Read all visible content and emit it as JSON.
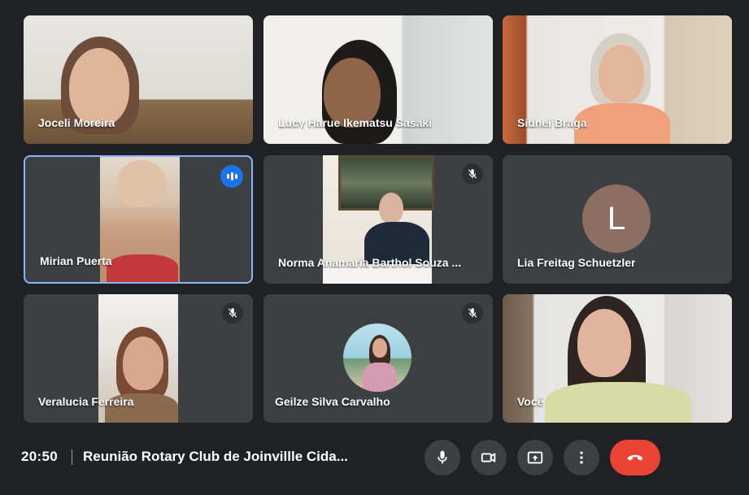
{
  "participants": [
    {
      "name": "Joceli Moreira"
    },
    {
      "name": "Lucy Harue Ikematsu Sasaki"
    },
    {
      "name": "Sidnei Braga"
    },
    {
      "name": "Mirian Puerta"
    },
    {
      "name": "Norma Anamaria Barthol Souza ..."
    },
    {
      "name": "Lia Freitag Schuetzler",
      "initial": "L"
    },
    {
      "name": "Veralucia Ferreira"
    },
    {
      "name": "Geilze Silva Carvalho"
    },
    {
      "name": "Você"
    }
  ],
  "toolbar": {
    "time": "20:50",
    "meeting_title": "Reunião Rotary Club de Joinvillle Cida..."
  },
  "colors": {
    "background": "#202124",
    "tile": "#3c4043",
    "active_border": "#8ab4f8",
    "speaking_indicator": "#1a73e8",
    "end_call": "#ea4335",
    "avatar_L": "#8d6e63"
  },
  "icons": [
    "mic-off-icon",
    "speaking-indicator-icon",
    "mic-icon",
    "camera-icon",
    "present-screen-icon",
    "more-options-icon",
    "end-call-icon"
  ]
}
